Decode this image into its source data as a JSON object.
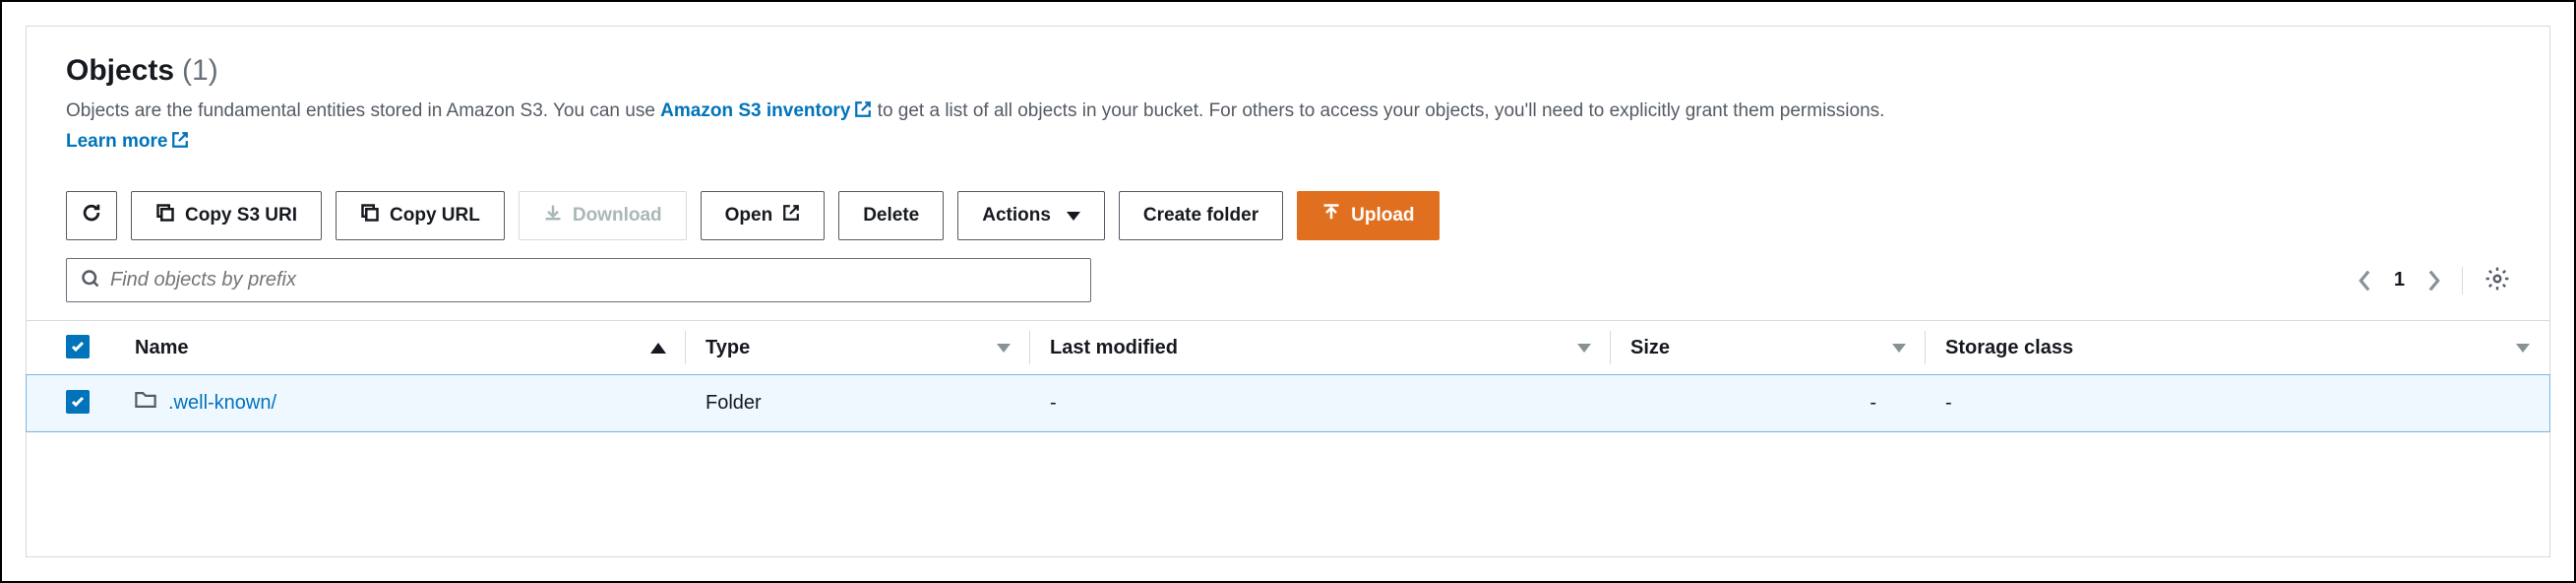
{
  "header": {
    "title": "Objects",
    "count": "(1)",
    "desc_prefix": "Objects are the fundamental entities stored in Amazon S3. You can use ",
    "inventory_link": "Amazon S3 inventory",
    "desc_suffix": " to get a list of all objects in your bucket. For others to access your objects, you'll need to explicitly grant them permissions. ",
    "learn_more": "Learn more"
  },
  "toolbar": {
    "copy_uri": "Copy S3 URI",
    "copy_url": "Copy URL",
    "download": "Download",
    "open": "Open",
    "delete": "Delete",
    "actions": "Actions",
    "create_folder": "Create folder",
    "upload": "Upload"
  },
  "search": {
    "placeholder": "Find objects by prefix"
  },
  "pagination": {
    "page": "1"
  },
  "columns": {
    "name": "Name",
    "type": "Type",
    "last_modified": "Last modified",
    "size": "Size",
    "storage_class": "Storage class"
  },
  "rows": [
    {
      "name": ".well-known/",
      "type": "Folder",
      "last_modified": "-",
      "size": "-",
      "storage_class": "-",
      "selected": true
    }
  ]
}
